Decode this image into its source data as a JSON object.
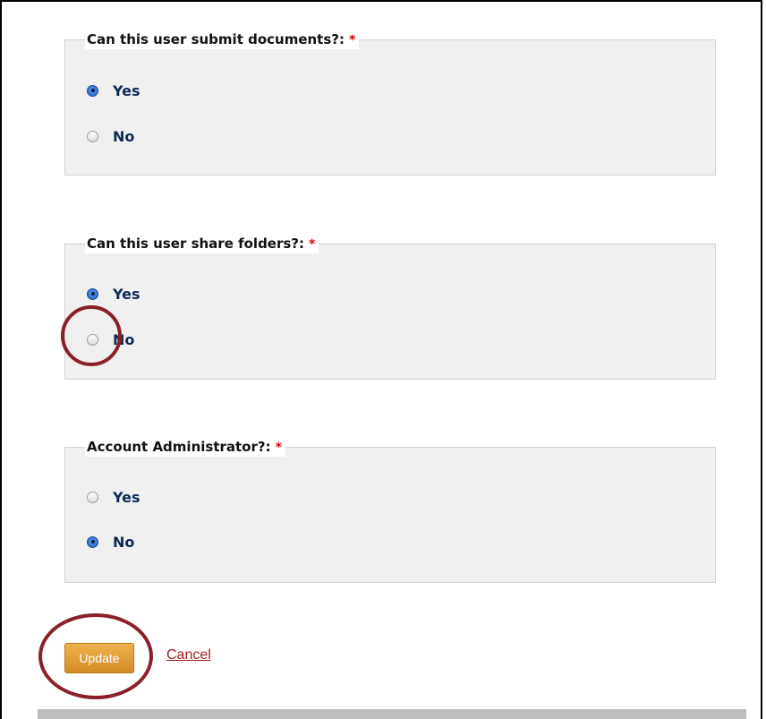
{
  "required_marker": "*",
  "groups": [
    {
      "legend": "Can this user submit documents?:",
      "options": [
        {
          "label": "Yes",
          "selected": true
        },
        {
          "label": "No",
          "selected": false
        }
      ]
    },
    {
      "legend": "Can this user share folders?:",
      "options": [
        {
          "label": "Yes",
          "selected": true
        },
        {
          "label": "No",
          "selected": false
        }
      ]
    },
    {
      "legend": "Account Administrator?:",
      "options": [
        {
          "label": "Yes",
          "selected": false
        },
        {
          "label": "No",
          "selected": true
        }
      ]
    }
  ],
  "actions": {
    "update_label": "Update",
    "cancel_label": "Cancel"
  },
  "colors": {
    "required": "#e00000",
    "option_text": "#0e2a56",
    "update_button": "#e0a03a",
    "cancel_link": "#9c1c1c",
    "highlight_circle": "#8b1f2a"
  }
}
